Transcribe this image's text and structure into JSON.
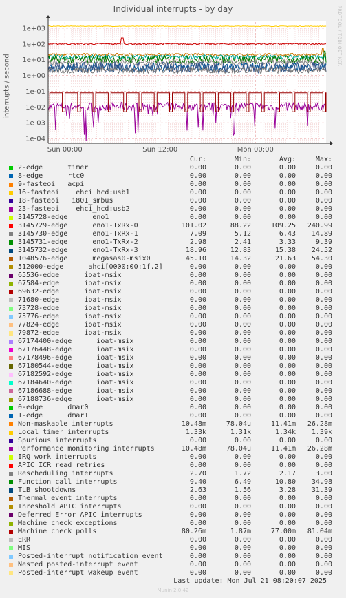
{
  "chart_data": {
    "type": "line",
    "title": "Individual interrupts - by day",
    "ylabel": "interrupts / second",
    "yscale": "log",
    "ylim": [
      5e-05,
      3000
    ],
    "yticks": [
      "1e+03",
      "1e+02",
      "1e+01",
      "1e+00",
      "1e-01",
      "1e-02",
      "1e-03",
      "1e-04"
    ],
    "ytick_values": [
      1000,
      100,
      10,
      1,
      0.1,
      0.01,
      0.001,
      0.0001
    ],
    "xticks": [
      "Sun 00:00",
      "Sun 12:00",
      "Mon 00:00"
    ],
    "xtick_hours": [
      0,
      12,
      24
    ],
    "xrange_hours": [
      -2.1,
      32.9
    ],
    "grid": true,
    "watermark": "RRDTOOL / TOBI OETIKER",
    "lines": [
      {
        "name": "Local timer interrupts",
        "color": "#FFCC00",
        "level": 1330,
        "noise": 0.02,
        "spikes": []
      },
      {
        "name": "3145729-edge enol1-TxRx-0",
        "color": "#CC0000",
        "level": 101,
        "noise": 0.05,
        "spikes": [
          [
            7.2,
            2.4
          ]
        ]
      },
      {
        "name": "1048576-edge megasas0-msix0",
        "color": "#CC7700",
        "level": 21,
        "noise": 0.08,
        "spikes": [
          [
            32.5,
            2.6
          ]
        ]
      },
      {
        "name": "3145732-edge enol1-TxRx-3",
        "color": "#00AA99",
        "level": 15,
        "noise": 0.12,
        "spikes": []
      },
      {
        "name": "Function call interrupts",
        "color": "#007700",
        "level": 10,
        "noise": 0.25,
        "spikes": [
          [
            32.7,
            3.5
          ]
        ]
      },
      {
        "name": "3145730-edge enol1-TxRx-1",
        "color": "#888888",
        "level": 6.4,
        "noise": 0.15,
        "spikes": []
      },
      {
        "name": "3145731-edge enol1-TxRx-2",
        "color": "#005599",
        "level": 3.3,
        "noise": 0.25,
        "spikes": []
      },
      {
        "name": "TLB shootdowns",
        "color": "#335588",
        "level": 3.3,
        "noise": 0.35,
        "spikes": []
      },
      {
        "name": "Rescheduling interrupts",
        "color": "#777777",
        "level": 2.2,
        "noise": 0.2,
        "spikes": []
      }
    ],
    "pulse_line": {
      "name": "Machine check polls",
      "color": "#990000",
      "high": 0.08,
      "low": 0.005,
      "period_hours": 1.93,
      "high_fraction": 0.82
    },
    "noisy_line": {
      "name": "Non-maskable interrupts",
      "color": "#990099",
      "level": 0.011,
      "min": 5e-05
    }
  },
  "legend": {
    "headers": {
      "cur": "Cur:",
      "min": "Min:",
      "avg": "Avg:",
      "max": "Max:"
    },
    "rows": [
      {
        "name": "2-edge      timer",
        "color": "#00CC00",
        "cur": "0.00",
        "min": "0.00",
        "avg": "0.00",
        "max": "0.00"
      },
      {
        "name": "8-edge      rtc0",
        "color": "#0066B3",
        "cur": "0.00",
        "min": "0.00",
        "avg": "0.00",
        "max": "0.00"
      },
      {
        "name": "9-fasteoi   acpi",
        "color": "#FF8000",
        "cur": "0.00",
        "min": "0.00",
        "avg": "0.00",
        "max": "0.00"
      },
      {
        "name": "16-fasteoi    ehci_hcd:usb1",
        "color": "#FFCC00",
        "cur": "0.00",
        "min": "0.00",
        "avg": "0.00",
        "max": "0.00"
      },
      {
        "name": "18-fasteoi   i801_smbus",
        "color": "#330099",
        "cur": "0.00",
        "min": "0.00",
        "avg": "0.00",
        "max": "0.00"
      },
      {
        "name": "23-fasteoi    ehci_hcd:usb2",
        "color": "#990099",
        "cur": "0.00",
        "min": "0.00",
        "avg": "0.00",
        "max": "0.00"
      },
      {
        "name": "3145728-edge      eno1",
        "color": "#CCFF00",
        "cur": "0.00",
        "min": "0.00",
        "avg": "0.00",
        "max": "0.00"
      },
      {
        "name": "3145729-edge      eno1-TxRx-0",
        "color": "#FF0000",
        "cur": "101.02",
        "min": "88.22",
        "avg": "109.25",
        "max": "240.99"
      },
      {
        "name": "3145730-edge      eno1-TxRx-1",
        "color": "#808080",
        "cur": "7.09",
        "min": "5.12",
        "avg": "6.43",
        "max": "14.89"
      },
      {
        "name": "3145731-edge      eno1-TxRx-2",
        "color": "#008F00",
        "cur": "2.98",
        "min": "2.41",
        "avg": "3.33",
        "max": "9.39"
      },
      {
        "name": "3145732-edge      eno1-TxRx-3",
        "color": "#00487D",
        "cur": "18.96",
        "min": "12.83",
        "avg": "15.38",
        "max": "24.52"
      },
      {
        "name": "1048576-edge      megasas0-msix0",
        "color": "#B35A00",
        "cur": "45.10",
        "min": "14.32",
        "avg": "21.63",
        "max": "54.30"
      },
      {
        "name": "512000-edge      ahci[0000:00:1f.2]",
        "color": "#B38F00",
        "cur": "0.00",
        "min": "0.00",
        "avg": "0.00",
        "max": "0.00"
      },
      {
        "name": "65536-edge      ioat-msix",
        "color": "#6B006B",
        "cur": "0.00",
        "min": "0.00",
        "avg": "0.00",
        "max": "0.00"
      },
      {
        "name": "67584-edge      ioat-msix",
        "color": "#8FB300",
        "cur": "0.00",
        "min": "0.00",
        "avg": "0.00",
        "max": "0.00"
      },
      {
        "name": "69632-edge      ioat-msix",
        "color": "#B30000",
        "cur": "0.00",
        "min": "0.00",
        "avg": "0.00",
        "max": "0.00"
      },
      {
        "name": "71680-edge      ioat-msix",
        "color": "#BEBEBE",
        "cur": "0.00",
        "min": "0.00",
        "avg": "0.00",
        "max": "0.00"
      },
      {
        "name": "73728-edge      ioat-msix",
        "color": "#80FF80",
        "cur": "0.00",
        "min": "0.00",
        "avg": "0.00",
        "max": "0.00"
      },
      {
        "name": "75776-edge      ioat-msix",
        "color": "#80C9FF",
        "cur": "0.00",
        "min": "0.00",
        "avg": "0.00",
        "max": "0.00"
      },
      {
        "name": "77824-edge      ioat-msix",
        "color": "#FFC080",
        "cur": "0.00",
        "min": "0.00",
        "avg": "0.00",
        "max": "0.00"
      },
      {
        "name": "79872-edge      ioat-msix",
        "color": "#FFE680",
        "cur": "0.00",
        "min": "0.00",
        "avg": "0.00",
        "max": "0.00"
      },
      {
        "name": "67174400-edge      ioat-msix",
        "color": "#AA80FF",
        "cur": "0.00",
        "min": "0.00",
        "avg": "0.00",
        "max": "0.00"
      },
      {
        "name": "67176448-edge      ioat-msix",
        "color": "#EE00CC",
        "cur": "0.00",
        "min": "0.00",
        "avg": "0.00",
        "max": "0.00"
      },
      {
        "name": "67178496-edge      ioat-msix",
        "color": "#FF8080",
        "cur": "0.00",
        "min": "0.00",
        "avg": "0.00",
        "max": "0.00"
      },
      {
        "name": "67180544-edge      ioat-msix",
        "color": "#666600",
        "cur": "0.00",
        "min": "0.00",
        "avg": "0.00",
        "max": "0.00"
      },
      {
        "name": "67182592-edge      ioat-msix",
        "color": "#FFBFFF",
        "cur": "0.00",
        "min": "0.00",
        "avg": "0.00",
        "max": "0.00"
      },
      {
        "name": "67184640-edge      ioat-msix",
        "color": "#00FFCC",
        "cur": "0.00",
        "min": "0.00",
        "avg": "0.00",
        "max": "0.00"
      },
      {
        "name": "67186688-edge      ioat-msix",
        "color": "#CC6699",
        "cur": "0.00",
        "min": "0.00",
        "avg": "0.00",
        "max": "0.00"
      },
      {
        "name": "67188736-edge      ioat-msix",
        "color": "#999900",
        "cur": "0.00",
        "min": "0.00",
        "avg": "0.00",
        "max": "0.00"
      },
      {
        "name": "0-edge      dmar0",
        "color": "#00CC00",
        "cur": "0.00",
        "min": "0.00",
        "avg": "0.00",
        "max": "0.00"
      },
      {
        "name": "1-edge      dmar1",
        "color": "#0066B3",
        "cur": "0.00",
        "min": "0.00",
        "avg": "0.00",
        "max": "0.00"
      },
      {
        "name": "Non-maskable interrupts",
        "color": "#FF8000",
        "cur": "10.48m",
        "min": "78.04u",
        "avg": "11.41m",
        "max": "26.28m"
      },
      {
        "name": "Local timer interrupts",
        "color": "#FFCC00",
        "cur": "1.33k",
        "min": "1.31k",
        "avg": "1.34k",
        "max": "1.39k"
      },
      {
        "name": "Spurious interrupts",
        "color": "#330099",
        "cur": "0.00",
        "min": "0.00",
        "avg": "0.00",
        "max": "0.00"
      },
      {
        "name": "Performance monitoring interrupts",
        "color": "#990099",
        "cur": "10.48m",
        "min": "78.04u",
        "avg": "11.41m",
        "max": "26.28m"
      },
      {
        "name": "IRQ work interrupts",
        "color": "#CCFF00",
        "cur": "0.00",
        "min": "0.00",
        "avg": "0.00",
        "max": "0.00"
      },
      {
        "name": "APIC ICR read retries",
        "color": "#FF0000",
        "cur": "0.00",
        "min": "0.00",
        "avg": "0.00",
        "max": "0.00"
      },
      {
        "name": "Rescheduling interrupts",
        "color": "#808080",
        "cur": "2.70",
        "min": "1.72",
        "avg": "2.17",
        "max": "3.00"
      },
      {
        "name": "Function call interrupts",
        "color": "#008F00",
        "cur": "9.40",
        "min": "6.49",
        "avg": "10.80",
        "max": "34.98"
      },
      {
        "name": "TLB shootdowns",
        "color": "#00487D",
        "cur": "2.63",
        "min": "1.56",
        "avg": "3.28",
        "max": "31.39"
      },
      {
        "name": "Thermal event interrupts",
        "color": "#B35A00",
        "cur": "0.00",
        "min": "0.00",
        "avg": "0.00",
        "max": "0.00"
      },
      {
        "name": "Threshold APIC interrupts",
        "color": "#B38F00",
        "cur": "0.00",
        "min": "0.00",
        "avg": "0.00",
        "max": "0.00"
      },
      {
        "name": "Deferred Error APIC interrupts",
        "color": "#6B006B",
        "cur": "0.00",
        "min": "0.00",
        "avg": "0.00",
        "max": "0.00"
      },
      {
        "name": "Machine check exceptions",
        "color": "#8FB300",
        "cur": "0.00",
        "min": "0.00",
        "avg": "0.00",
        "max": "0.00"
      },
      {
        "name": "Machine check polls",
        "color": "#B30000",
        "cur": "80.26m",
        "min": "1.87m",
        "avg": "77.00m",
        "max": "81.04m"
      },
      {
        "name": "ERR",
        "color": "#BEBEBE",
        "cur": "0.00",
        "min": "0.00",
        "avg": "0.00",
        "max": "0.00"
      },
      {
        "name": "MIS",
        "color": "#80FF80",
        "cur": "0.00",
        "min": "0.00",
        "avg": "0.00",
        "max": "0.00"
      },
      {
        "name": "Posted-interrupt notification event",
        "color": "#80C9FF",
        "cur": "0.00",
        "min": "0.00",
        "avg": "0.00",
        "max": "0.00"
      },
      {
        "name": "Nested posted-interrupt event",
        "color": "#FFC080",
        "cur": "0.00",
        "min": "0.00",
        "avg": "0.00",
        "max": "0.00"
      },
      {
        "name": "Posted-interrupt wakeup event",
        "color": "#FFE680",
        "cur": "0.00",
        "min": "0.00",
        "avg": "0.00",
        "max": "0.00"
      }
    ]
  },
  "footer": {
    "last_update": "Last update: Mon Jul 21 08:20:07 2025",
    "generator": "Munin 2.0.42"
  }
}
